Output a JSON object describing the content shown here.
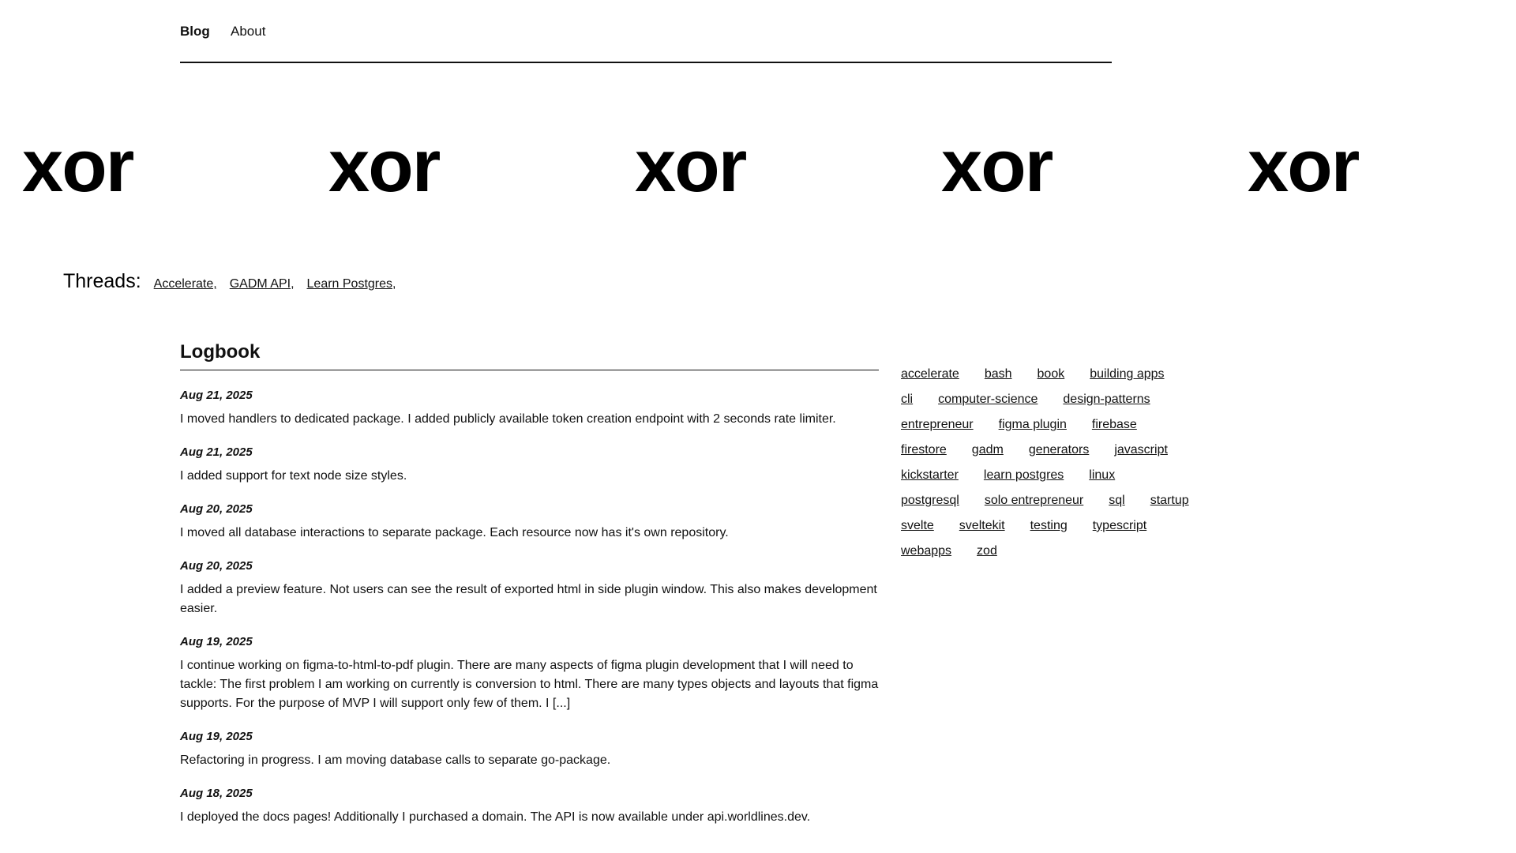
{
  "nav": {
    "blog_label": "Blog",
    "about_label": "About"
  },
  "banner": {
    "items": [
      "xor",
      "xor",
      "xor",
      "xor",
      "xor"
    ]
  },
  "threads": {
    "label": "Threads:",
    "links": [
      "Accelerate,",
      "GADM API,",
      "Learn Postgres,"
    ]
  },
  "logbook": {
    "title": "Logbook",
    "entries": [
      {
        "date": "Aug 21, 2025",
        "text": "I moved handlers to dedicated package. I added publicly available token creation endpoint with 2 seconds rate limiter."
      },
      {
        "date": "Aug 21, 2025",
        "text": "I added support for text node size styles."
      },
      {
        "date": "Aug 20, 2025",
        "text": "I moved all database interactions to separate package. Each resource now has it's own repository."
      },
      {
        "date": "Aug 20, 2025",
        "text": "I added a preview feature. Not users can see the result of exported html in side plugin window. This also makes development easier."
      },
      {
        "date": "Aug 19, 2025",
        "text": "I continue working on figma-to-html-to-pdf plugin. There are many aspects of figma plugin development that I will need to tackle: The first problem I am working on currently is conversion to html. There are many types objects and layouts that figma supports. For the purpose of MVP I will support only few of them. I [...]"
      },
      {
        "date": "Aug 19, 2025",
        "text": "Refactoring in progress. I am moving database calls to separate go-package."
      },
      {
        "date": "Aug 18, 2025",
        "text": "I deployed the docs pages! Additionally I purchased a domain. The API is now available under api.worldlines.dev."
      }
    ]
  },
  "tags": {
    "rows": [
      [
        "accelerate",
        "bash",
        "book",
        "building apps"
      ],
      [
        "cli",
        "computer-science",
        "design-patterns"
      ],
      [
        "entrepreneur",
        "figma plugin",
        "firebase"
      ],
      [
        "firestore",
        "gadm",
        "generators",
        "javascript"
      ],
      [
        "kickstarter",
        "learn postgres",
        "linux"
      ],
      [
        "postgresql",
        "solo entrepreneur",
        "sql",
        "startup"
      ],
      [
        "svelte",
        "sveltekit",
        "testing",
        "typescript"
      ],
      [
        "webapps",
        "zod"
      ]
    ]
  }
}
